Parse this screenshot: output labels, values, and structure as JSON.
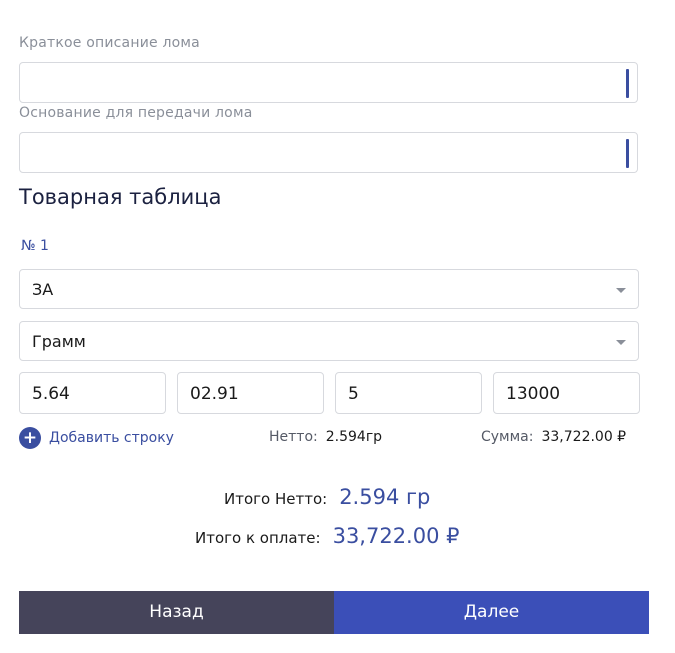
{
  "form": {
    "short_description_label": "Краткое описание лома",
    "short_description_value": "",
    "basis_label": "Основание для передачи лома",
    "basis_value": ""
  },
  "goods_table": {
    "title": "Товарная таблица",
    "rows": [
      {
        "number_label": "№ 1",
        "item_select": "ЗА",
        "unit_select": "Грамм",
        "inputs": [
          "5.64",
          "02.91",
          "5",
          "13000"
        ],
        "netto_label": "Нетто:",
        "netto_value": "2.594гр",
        "sum_label": "Сумма:",
        "sum_value": "33,722.00 ₽"
      }
    ],
    "add_row_label": "Добавить строку",
    "add_row_icon": "plus-icon"
  },
  "totals": {
    "netto_label": "Итого Нетто:",
    "netto_value": "2.594 гр",
    "payment_label": "Итого к оплате:",
    "payment_value": "33,722.00 ₽"
  },
  "actions": {
    "back_label": "Назад",
    "next_label": "Далее"
  },
  "colors": {
    "accent": "#3a4ea0",
    "next_button": "#3b4fb8",
    "back_button": "#45445a"
  }
}
